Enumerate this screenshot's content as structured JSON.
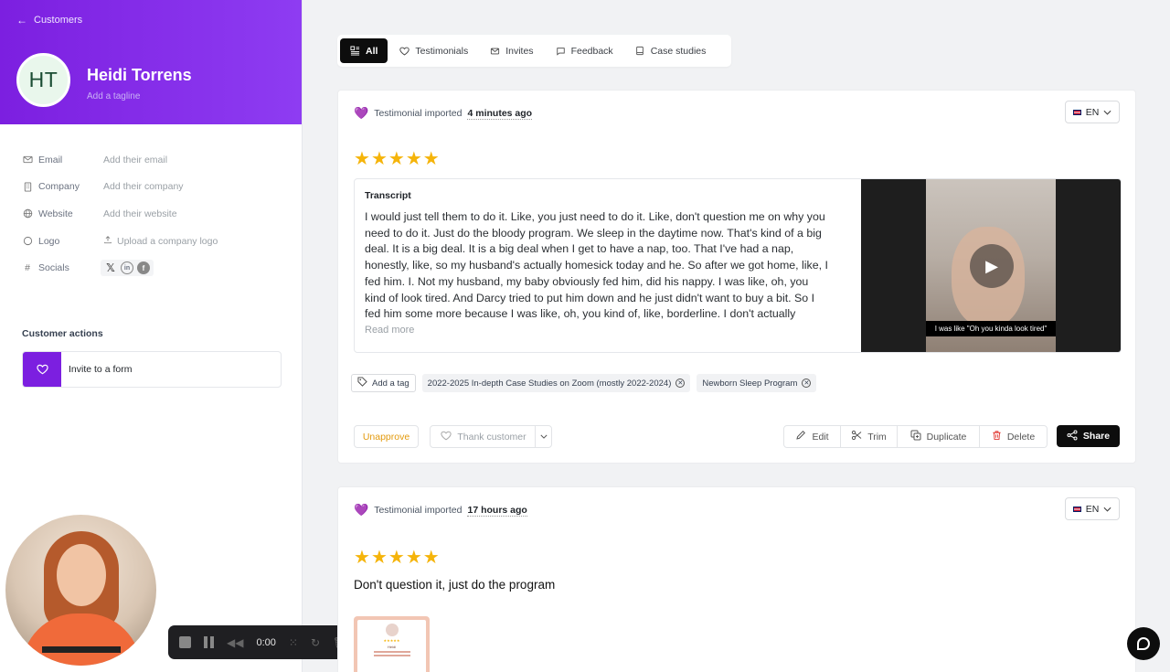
{
  "sidebar": {
    "back_label": "Customers",
    "initials": "HT",
    "name": "Heidi Torrens",
    "tagline": "Add a tagline",
    "fields": [
      {
        "label": "Email",
        "value": "Add their email",
        "icon": "mail-icon"
      },
      {
        "label": "Company",
        "value": "Add their company",
        "icon": "building-icon"
      },
      {
        "label": "Website",
        "value": "Add their website",
        "icon": "globe-icon"
      },
      {
        "label": "Logo",
        "value": "Upload a company logo",
        "icon": "upload-icon"
      },
      {
        "label": "Socials",
        "value": "",
        "icon": "hash-icon"
      }
    ],
    "customer_actions_title": "Customer actions",
    "invite_label": "Invite to a form",
    "brand_color": "#7c1fe0"
  },
  "recorder": {
    "time": "0:00"
  },
  "tabs": [
    {
      "label": "All",
      "icon": "grid-icon",
      "active": true
    },
    {
      "label": "Testimonials",
      "icon": "heart-outline-icon",
      "active": false
    },
    {
      "label": "Invites",
      "icon": "mail-icon",
      "active": false
    },
    {
      "label": "Feedback",
      "icon": "message-icon",
      "active": false
    },
    {
      "label": "Case studies",
      "icon": "book-icon",
      "active": false
    }
  ],
  "card1": {
    "meta_prefix": "Testimonial imported",
    "meta_time": "4 minutes ago",
    "language": "EN",
    "rating": 5,
    "transcript_title": "Transcript",
    "transcript_body": "I would just tell them to do it. Like, you just need to do it. Like, don't question me on why you need to do it. Just do the bloody program. We sleep in the daytime now. That's kind of a big deal. It is a big deal. It is a big deal when I get to have a nap, too. That I've had a nap, honestly, like, so my husband's actually homesick today and he. So after we got home, like, I fed him. I. Not my husband, my baby obviously fed him, did his nappy. I was like, oh, you kind of look tired. And Darcy tried to put him down and he just didn't want to buy a bit. So I fed him some more because I was like, oh, you kind of, like, borderline. I don't actually know...",
    "read_more": "Read more",
    "video_caption": "I was like \"Oh you kinda look tired\"",
    "add_tag": "Add a tag",
    "tags": [
      "2022-2025 In-depth Case Studies on Zoom (mostly 2022-2024)",
      "Newborn Sleep Program"
    ],
    "unapprove": "Unapprove",
    "thank_customer": "Thank customer",
    "edit": "Edit",
    "trim": "Trim",
    "duplicate": "Duplicate",
    "delete": "Delete",
    "share": "Share"
  },
  "card2": {
    "meta_prefix": "Testimonial imported",
    "meta_time": "17 hours ago",
    "language": "EN",
    "rating": 5,
    "title": "Don't question it, just do the program",
    "thumb_name": "Heidi"
  }
}
